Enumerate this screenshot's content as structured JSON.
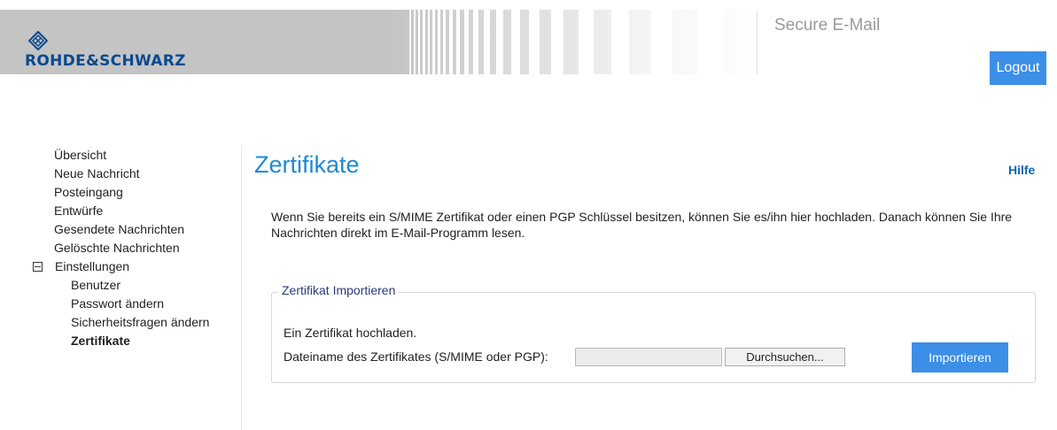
{
  "header": {
    "logo_text": "ROHDE&SCHWARZ",
    "app_name": "Secure E-Mail",
    "logout_label": "Logout"
  },
  "sidebar": {
    "items": [
      {
        "label": "Übersicht"
      },
      {
        "label": "Neue Nachricht"
      },
      {
        "label": "Posteingang"
      },
      {
        "label": "Entwürfe"
      },
      {
        "label": "Gesendete Nachrichten"
      },
      {
        "label": "Gelöschte Nachrichten"
      }
    ],
    "settings": {
      "label": "Einstellungen",
      "expanded": true,
      "children": [
        {
          "label": "Benutzer"
        },
        {
          "label": "Passwort ändern"
        },
        {
          "label": "Sicherheitsfragen ändern"
        },
        {
          "label": "Zertifikate",
          "active": true
        }
      ]
    }
  },
  "main": {
    "title": "Zertifikate",
    "help_label": "Hilfe",
    "intro_text": "Wenn Sie bereits ein S/MIME Zertifikat oder einen PGP Schlüssel besitzen, können Sie es/ihn hier hochladen. Danach können Sie Ihre Nachrichten direkt im E-Mail-Programm lesen.",
    "import_section": {
      "legend": "Zertifikat Importieren",
      "upload_caption": "Ein Zertifikat hochladen.",
      "file_label": "Dateiname des Zertifikates (S/MIME oder PGP):",
      "file_value": "",
      "browse_label": "Durchsuchen...",
      "import_label": "Importieren"
    }
  },
  "colors": {
    "accent": "#3c8fe7",
    "title": "#1f8ad3",
    "brand": "#0a4a8f",
    "header_band": "#c4c4c4"
  }
}
